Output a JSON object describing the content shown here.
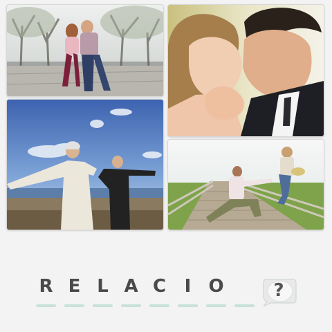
{
  "game": {
    "photos": [
      {
        "scene": "couple-embracing-in-park"
      },
      {
        "scene": "couple-forehead-to-forehead"
      },
      {
        "scene": "elderly-couple-on-beach"
      },
      {
        "scene": "man-proposing-on-boardwalk"
      }
    ],
    "answer_letters": [
      "R",
      "E",
      "L",
      "A",
      "C",
      "I",
      "O",
      ""
    ],
    "hint_label": "?",
    "colors": {
      "background": "#f3f3f3",
      "letter": "#4a4a4a",
      "underline": "#c8e2d9",
      "hint_bubble": "#e9e9e9"
    }
  }
}
